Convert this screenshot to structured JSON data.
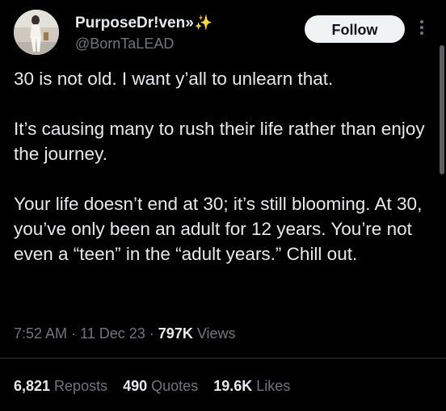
{
  "user": {
    "display_name": "PurposeDr!ven»",
    "sparkle": "✨",
    "handle": "@BornTaLEAD"
  },
  "follow_label": "Follow",
  "tweet": {
    "paragraphs": [
      "30 is not old. I want y’all to unlearn that.",
      "It’s causing many to rush their life rather than enjoy the journey.",
      "Your life doesn’t end at 30; it’s still blooming. At 30, you’ve only been an adult for 12 years. You’re not even a “teen” in the “adult years.” Chill out."
    ]
  },
  "meta": {
    "time": "7:52 AM",
    "date": "11 Dec 23",
    "views_count": "797K",
    "views_label": "Views"
  },
  "stats": {
    "reposts_count": "6,821",
    "reposts_label": "Reposts",
    "quotes_count": "490",
    "quotes_label": "Quotes",
    "likes_count": "19.6K",
    "likes_label": "Likes"
  },
  "colors": {
    "background": "#000000",
    "text_primary": "#e7e9ea",
    "text_secondary": "#71767b",
    "follow_bg": "#eff3f4",
    "divider": "#2f3336"
  }
}
